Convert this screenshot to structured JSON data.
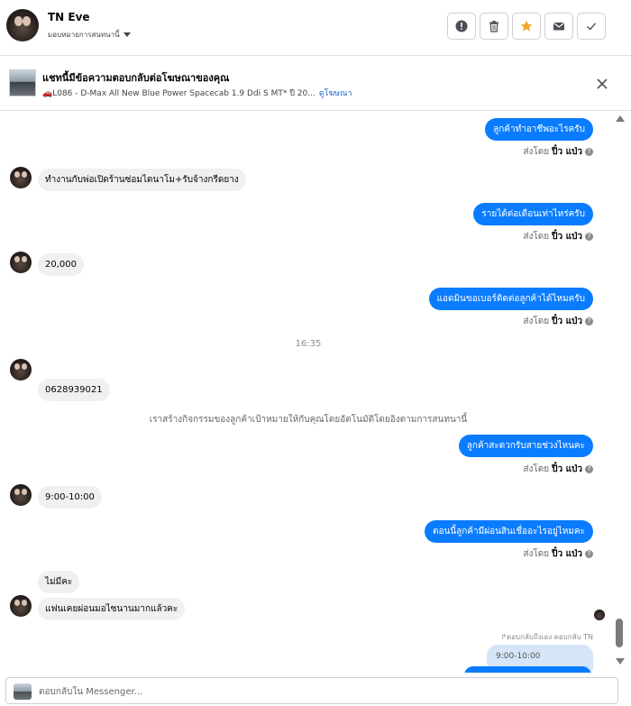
{
  "header": {
    "name": "TN Eve",
    "assign_label": "มอบหมายการสนทนานี้",
    "actions": [
      {
        "name": "report-icon",
        "label": "!"
      },
      {
        "name": "trash-icon",
        "label": ""
      },
      {
        "name": "star-icon",
        "label": "",
        "color": "#f5a623"
      },
      {
        "name": "mail-icon",
        "label": ""
      },
      {
        "name": "check-icon",
        "label": ""
      }
    ]
  },
  "ad_banner": {
    "title": "แชทนี้มีข้อความตอบกลับต่อโฆษณาของคุณ",
    "subtitle": "🚗L086 - D-Max All New Blue Power Spacecab 1.9 Ddi S MT* ปี 20...",
    "link": "ดูโฆษณา"
  },
  "messages": [
    {
      "type": "out",
      "text": "ลูกค้าทำอาชีพอะไรครับ",
      "sent_by_prefix": "ส่งโดย",
      "sent_by_name": "ปิ๋ว แป่ว"
    },
    {
      "type": "in",
      "text": "ทำงานกับพ่อเปิดร้านซ่อมไดนาโม+รับจ้างกรีดยาง"
    },
    {
      "type": "out",
      "text": "รายได้ต่อเดือนเท่าไหร่ครับ",
      "sent_by_prefix": "ส่งโดย",
      "sent_by_name": "ปิ๋ว แป่ว"
    },
    {
      "type": "in",
      "text": "20,000"
    },
    {
      "type": "out",
      "text": "แอดมินขอเบอร์ติดต่อลูกค้าได้ไหมครับ",
      "sent_by_prefix": "ส่งโดย",
      "sent_by_name": "ปิ๋ว แป่ว"
    },
    {
      "type": "time",
      "text": "16:35"
    },
    {
      "type": "in",
      "text": "0628939021"
    },
    {
      "type": "system",
      "text": "เราสร้างกิจกรรมของลูกค้าเป้าหมายให้กับคุณโดยอัตโนมัติโดยอิงตามการสนทนานี้"
    },
    {
      "type": "out",
      "text": "ลูกค้าสะดวกรับสายช่วงไหนคะ",
      "sent_by_prefix": "ส่งโดย",
      "sent_by_name": "ปิ๋ว แป่ว"
    },
    {
      "type": "in",
      "text": "9:00-10:00"
    },
    {
      "type": "out",
      "text": "ตอนนี้ลูกค้ามีผ่อนสินเชื่ออะไรอยู่ไหมคะ",
      "sent_by_prefix": "ส่งโดย",
      "sent_by_name": "ปิ๋ว แป่ว"
    },
    {
      "type": "in",
      "text": "ไม่มีคะ"
    },
    {
      "type": "in",
      "text": "แฟนเคยผ่อนมอไซนานมากแล้วคะ"
    },
    {
      "type": "reply_note",
      "text": "↱ตอบกลับถึงเอง ตอบกลับ TN"
    },
    {
      "type": "quoted",
      "text": "9:00-10:00"
    }
  ],
  "composer": {
    "placeholder": "ตอบกลับใน Messenger..."
  },
  "colors": {
    "outgoing_bubble": "#0a7cff",
    "incoming_bubble": "#f0f0f0",
    "star": "#f5a623"
  }
}
